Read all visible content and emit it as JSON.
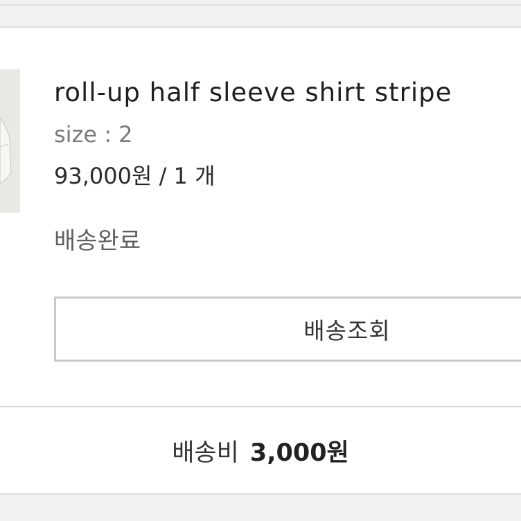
{
  "order": {
    "product_name": "roll-up half sleeve shirt stripe",
    "option": "size : 2",
    "price_quantity": "93,000원 / 1 개",
    "status": "배송완료",
    "track_button_label": "배송조회"
  },
  "shipping": {
    "label": "배송비",
    "amount": "3,000원"
  }
}
